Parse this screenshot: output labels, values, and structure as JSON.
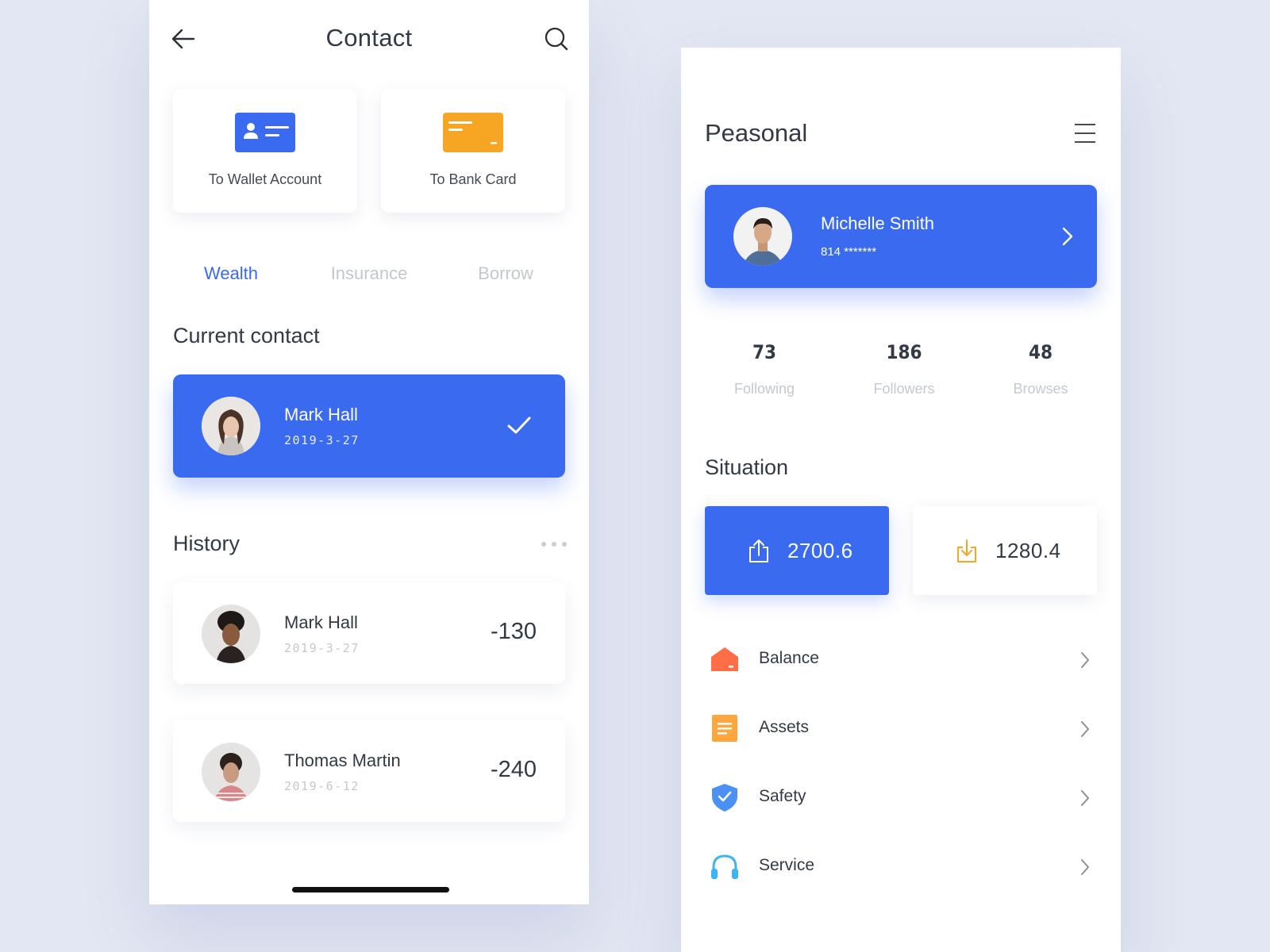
{
  "contact": {
    "title": "Contact",
    "transfers": [
      {
        "label": "To  Wallet Account",
        "icon": "id-card-icon",
        "color": "#3a6af0"
      },
      {
        "label": "To  Bank Card",
        "icon": "bank-card-icon",
        "color": "#f6a623"
      }
    ],
    "tabs": [
      {
        "label": "Wealth",
        "active": true
      },
      {
        "label": "Insurance",
        "active": false
      },
      {
        "label": "Borrow",
        "active": false
      }
    ],
    "current_contact": {
      "section_title": "Current contact",
      "name": "Mark Hall",
      "date": "2019-3-27"
    },
    "history": {
      "section_title": "History",
      "items": [
        {
          "name": "Mark Hall",
          "date": "2019-3-27",
          "amount": "-130"
        },
        {
          "name": "Thomas Martin",
          "date": "2019-6-12",
          "amount": "-240"
        }
      ]
    }
  },
  "personal": {
    "title": "Peasonal",
    "profile": {
      "name": "Michelle Smith",
      "id": "814 *******"
    },
    "stats": [
      {
        "value": "73",
        "label": "Following"
      },
      {
        "value": "186",
        "label": "Followers"
      },
      {
        "value": "48",
        "label": "Browses"
      }
    ],
    "situation": {
      "title": "Situation",
      "outgoing": "2700.6",
      "incoming": "1280.4"
    },
    "menu": [
      {
        "label": "Balance",
        "icon": "wallet-icon",
        "color": "#ff7043"
      },
      {
        "label": "Assets",
        "icon": "document-icon",
        "color": "#ffa63d"
      },
      {
        "label": "Safety",
        "icon": "shield-icon",
        "color": "#4a90f5"
      },
      {
        "label": "Service",
        "icon": "headphones-icon",
        "color": "#3db4ef"
      }
    ]
  },
  "colors": {
    "accent": "#3a6af0",
    "background": "#e3e7f3",
    "text": "#333a45",
    "muted": "#c4c8cf"
  }
}
